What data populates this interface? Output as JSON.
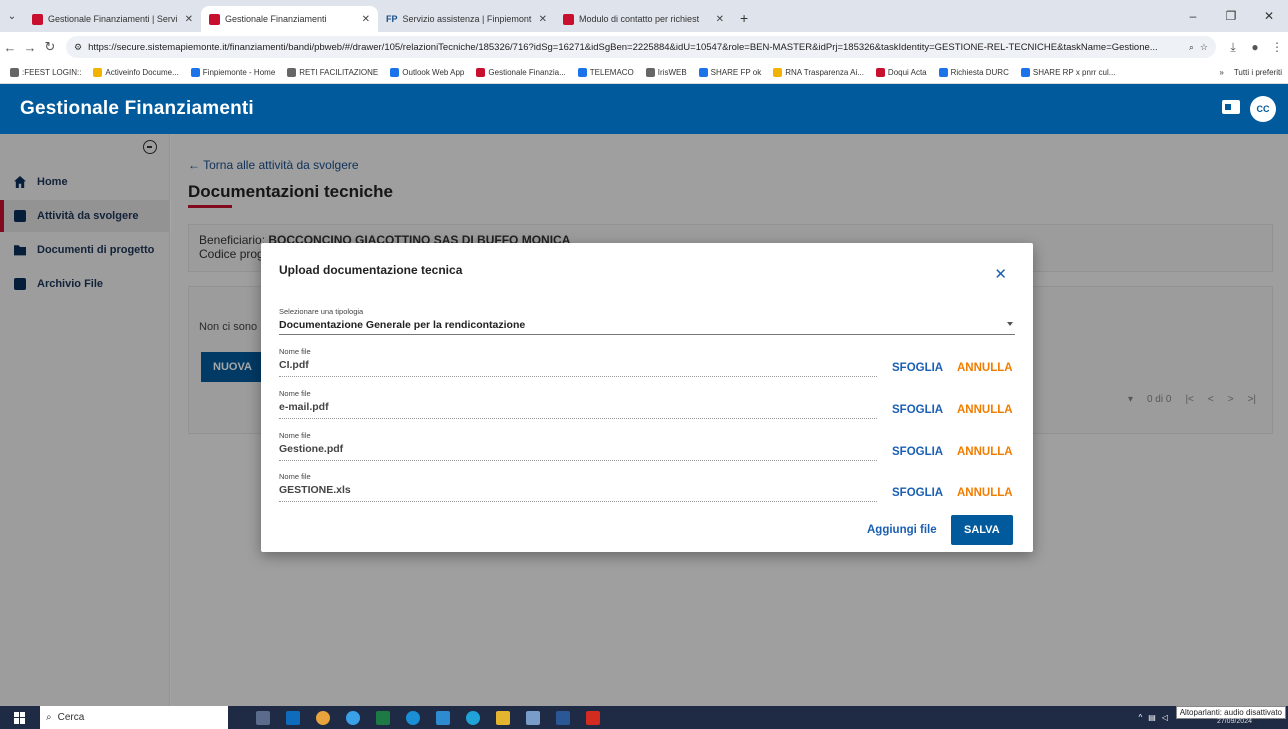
{
  "browser": {
    "tabs": [
      {
        "label": "Gestionale Finanziamenti | Servi",
        "active": false,
        "icon": "red-square-icon"
      },
      {
        "label": "Gestionale Finanziamenti",
        "active": true,
        "icon": "red-square-icon"
      },
      {
        "label": "Servizio assistenza | Finpiemont",
        "active": false,
        "icon": "fp-icon"
      },
      {
        "label": "Modulo di contatto per richiest",
        "active": false,
        "icon": "red-square-icon"
      }
    ],
    "url": "https://secure.sistemapiemonte.it/finanziamenti/bandi/pbweb/#/drawer/105/relazioniTecniche/185326/716?idSg=16271&idSgBen=2225884&idU=10547&role=BEN-MASTER&idPrj=185326&taskIdentity=GESTIONE-REL-TECNICHE&taskName=Gestione...",
    "bookmarks": [
      ":FEEST LOGIN::",
      "Activeinfo Docume...",
      "Finpiemonte - Home",
      "RETI FACILITAZIONE",
      "Outlook Web App",
      "Gestionale Finanzia...",
      "TELEMACO",
      "IrisWEB",
      "SHARE FP ok",
      "RNA Trasparenza Ai...",
      "Doqui Acta",
      "Richiesta DURC",
      "SHARE RP x pnrr cul..."
    ],
    "bookmarks_more": "»",
    "bookmarks_all": "Tutti i preferiti"
  },
  "app": {
    "title": "Gestionale Finanziamenti",
    "avatar": "CC"
  },
  "sidebar": {
    "items": [
      {
        "label": "Home",
        "icon": "home-icon",
        "active": false
      },
      {
        "label": "Attività da svolgere",
        "icon": "clipboard-icon",
        "active": true
      },
      {
        "label": "Documenti di progetto",
        "icon": "folder-icon",
        "active": false
      },
      {
        "label": "Archivio File",
        "icon": "file-icon",
        "active": false
      }
    ]
  },
  "main": {
    "back_link": "← Torna alle attività da svolgere",
    "page_title": "Documentazioni tecniche",
    "beneficiario_label": "Beneficiario:",
    "beneficiario_value": "BOCCONCINO GIACOTTINO SAS DI BUFFO MONICA",
    "codice_label": "Codice proge",
    "non_ci_sono": "Non ci sono",
    "nuova_button": "NUOVA",
    "pager_count": "0 di 0"
  },
  "dialog": {
    "title": "Upload documentazione tecnica",
    "tipologia_label": "Selezionare una tipologia",
    "tipologia_value": "Documentazione Generale per la rendicontazione",
    "file_label": "Nome file",
    "files": [
      "CI.pdf",
      "e-mail.pdf",
      "Gestione.pdf",
      "GESTIONE.xls"
    ],
    "sfoglia": "SFOGLIA",
    "annulla": "ANNULLA",
    "aggiungi": "Aggiungi file",
    "salva": "SALVA"
  },
  "taskbar": {
    "search": "Cerca",
    "tooltip": "Altoparlanti: audio disattivato",
    "date": "27/09/2024"
  },
  "colors": {
    "brand_blue": "#005a9c",
    "accent_red": "#c8102e",
    "cancel_orange": "#f07d00"
  }
}
